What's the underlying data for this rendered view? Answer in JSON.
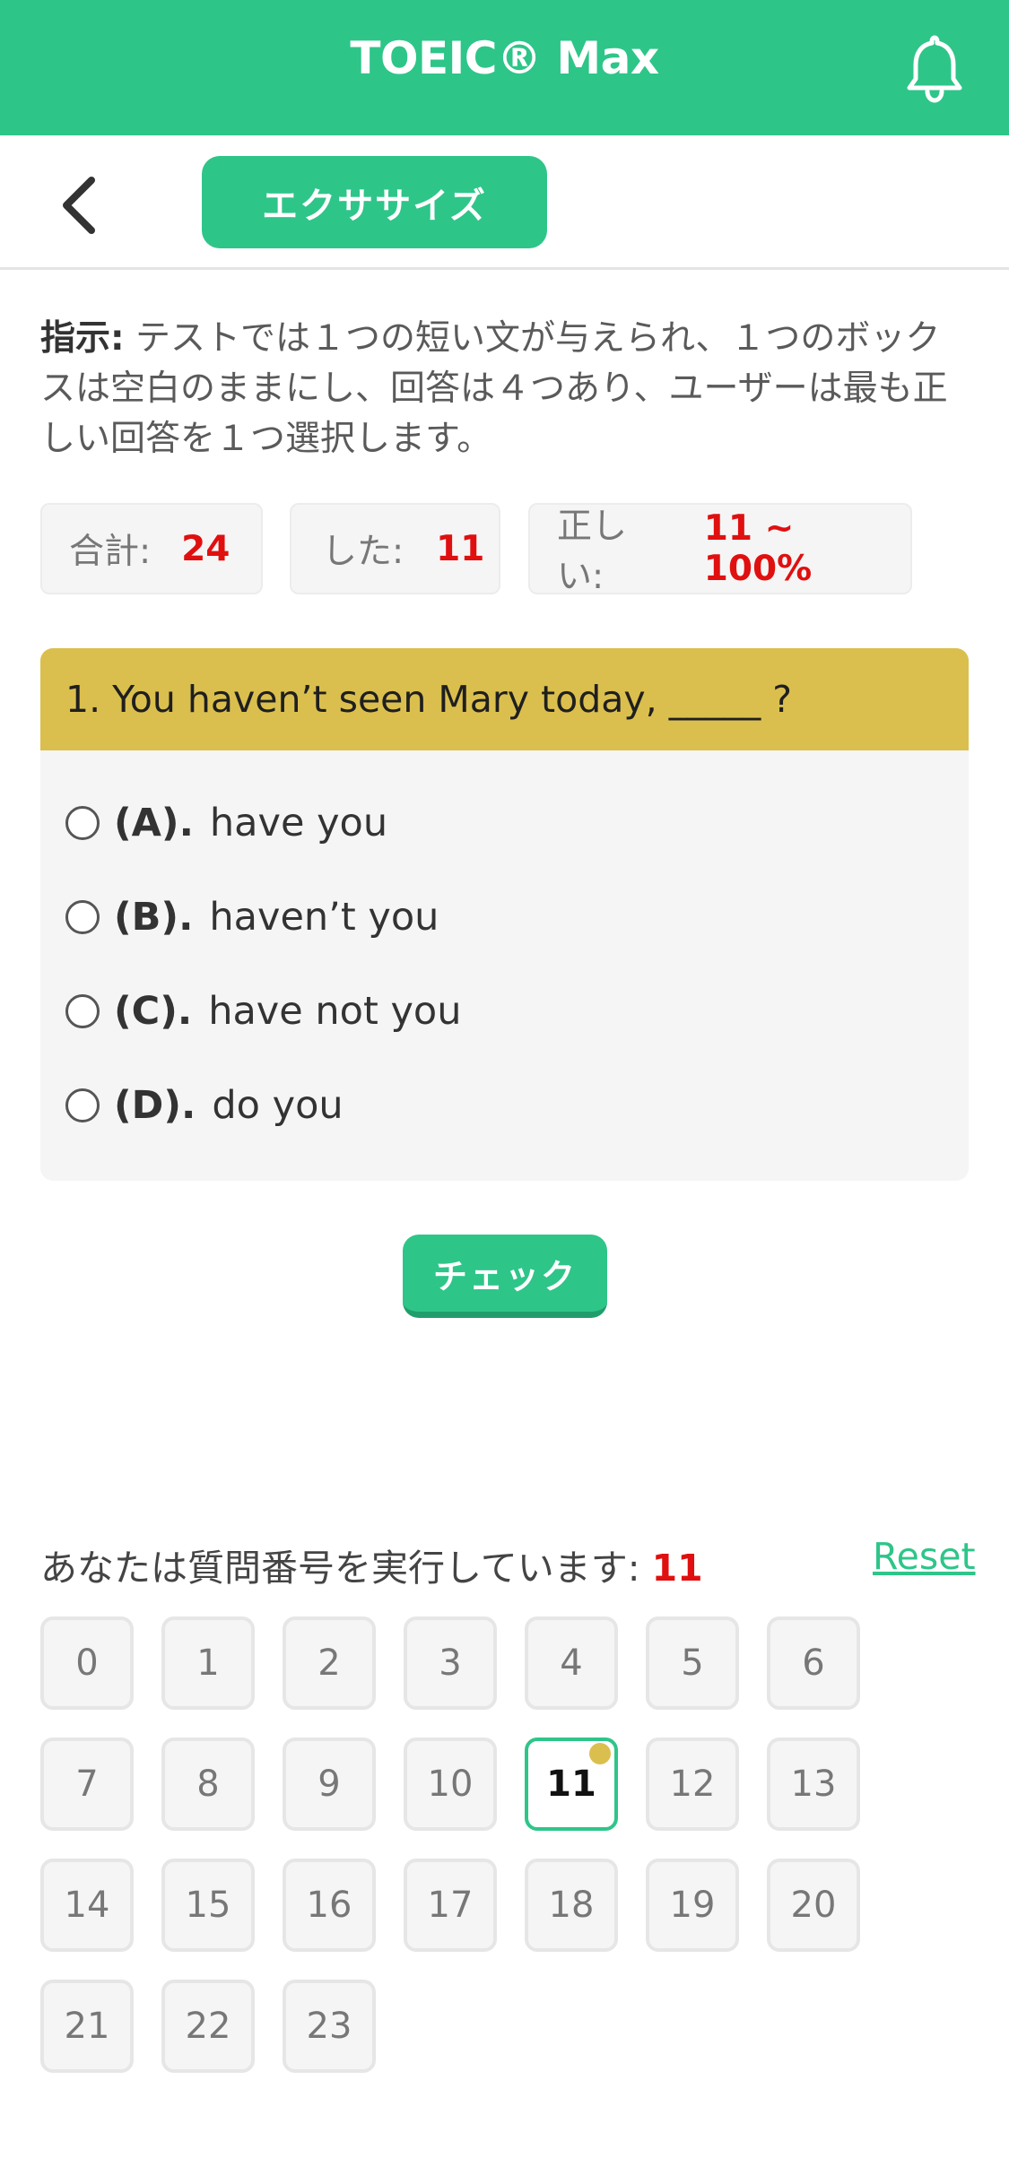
{
  "header": {
    "title": "TOEIC® Max",
    "icon": "bell-icon"
  },
  "subnav": {
    "back_icon": "chevron-left-icon",
    "exercise_label": "エクササイズ"
  },
  "instructions": {
    "label": "指示:",
    "text": " テストでは１つの短い文が与えられ、１つのボックスは空白のままにし、回答は４つあり、ユーザーは最も正しい回答を１つ選択します。"
  },
  "stats": {
    "total_label": "合計:",
    "total_value": "24",
    "done_label": "した:",
    "done_value": "11",
    "correct_label": "正しい:",
    "correct_value": "11 ~ 100%"
  },
  "question": {
    "text": "1. You haven’t seen Mary today, _____ ?",
    "options": [
      {
        "letter": "(A).",
        "text": "have you"
      },
      {
        "letter": "(B).",
        "text": "haven’t you"
      },
      {
        "letter": "(C).",
        "text": "have not you"
      },
      {
        "letter": "(D).",
        "text": "do you"
      }
    ]
  },
  "check_label": "チェック",
  "progress": {
    "label": "あなたは質問番号を実行しています:",
    "current": "11",
    "reset_label": "Reset"
  },
  "numbers": [
    "0",
    "1",
    "2",
    "3",
    "4",
    "5",
    "6",
    "7",
    "8",
    "9",
    "10",
    "11",
    "12",
    "13",
    "14",
    "15",
    "16",
    "17",
    "18",
    "19",
    "20",
    "21",
    "22",
    "23"
  ],
  "colors": {
    "brand_green": "#2ec589",
    "question_yellow": "#dbbf4e",
    "highlight_red": "#e01010"
  }
}
